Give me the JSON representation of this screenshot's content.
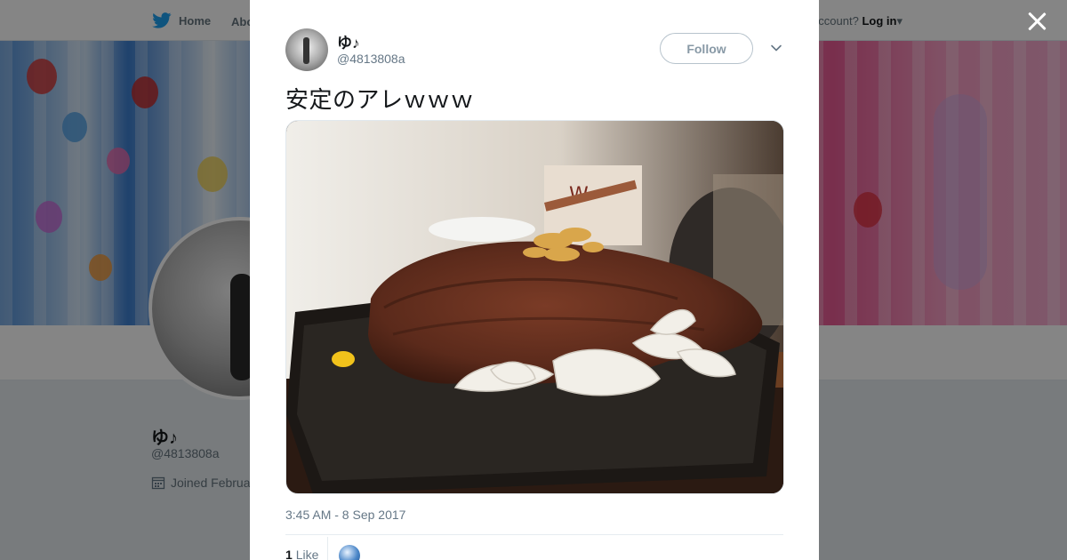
{
  "background_page": {
    "nav": {
      "home_label": "Home",
      "about_label": "Abo",
      "account_prefix": "ccount?",
      "login_label": "Log in"
    },
    "profile": {
      "name": "ゆ♪",
      "handle": "@4813808a",
      "joined_text": "Joined Februa"
    }
  },
  "tweet": {
    "author_name": "ゆ♪",
    "author_handle": "@4813808a",
    "follow_label": "Follow",
    "text": "安定のアレｗｗｗ",
    "timestamp": "3:45 AM - 8 Sep 2017",
    "like_count": "1",
    "like_label": "Like"
  },
  "colors": {
    "twitter_blue": "#1da1f2",
    "text_primary": "#14171a",
    "text_secondary": "#657786"
  },
  "icons": {
    "twitter_bird": "twitter-bird-icon",
    "close": "close-icon",
    "caret": "chevron-down-icon",
    "calendar": "calendar-icon"
  }
}
